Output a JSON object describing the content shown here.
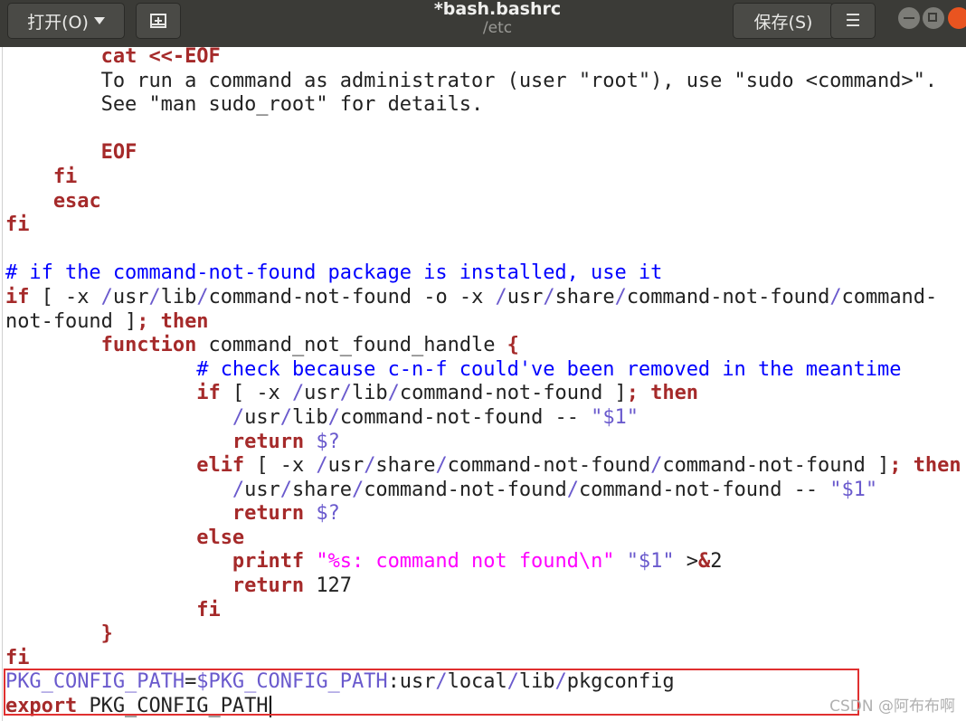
{
  "titlebar": {
    "open_label": "打开(O)",
    "title": "*bash.bashrc",
    "subtitle": "/etc",
    "save_label": "保存(S)",
    "menu_icon": "☰",
    "newdoc_icon": "new-document-icon"
  },
  "code_lines": [
    [
      [
        "        ",
        ""
      ],
      [
        "cat <<-EOF",
        "kw"
      ]
    ],
    [
      [
        "        To run a command as administrator (user \"root\"), use \"sudo <command>\".",
        ""
      ]
    ],
    [
      [
        "        See \"man sudo_root\" for details.",
        ""
      ]
    ],
    [
      [
        "",
        ""
      ]
    ],
    [
      [
        "        ",
        ""
      ],
      [
        "EOF",
        "kw"
      ]
    ],
    [
      [
        "    ",
        ""
      ],
      [
        "fi",
        "kw"
      ]
    ],
    [
      [
        "    ",
        ""
      ],
      [
        "esac",
        "kw"
      ]
    ],
    [
      [
        "fi",
        "kw"
      ]
    ],
    [
      [
        "",
        ""
      ]
    ],
    [
      [
        "# if the command-not-found package is installed, use it",
        "cm"
      ]
    ],
    [
      [
        "if",
        "kw"
      ],
      [
        " [ -x ",
        ""
      ],
      [
        "/",
        "sl"
      ],
      [
        "usr",
        ""
      ],
      [
        "/",
        "sl"
      ],
      [
        "lib",
        ""
      ],
      [
        "/",
        "sl"
      ],
      [
        "command-not-found -o -x ",
        ""
      ],
      [
        "/",
        "sl"
      ],
      [
        "usr",
        ""
      ],
      [
        "/",
        "sl"
      ],
      [
        "share",
        ""
      ],
      [
        "/",
        "sl"
      ],
      [
        "command-not-found",
        ""
      ],
      [
        "/",
        "sl"
      ],
      [
        "command-",
        ""
      ]
    ],
    [
      [
        "not-found ]",
        ""
      ],
      [
        "; then",
        "kw"
      ]
    ],
    [
      [
        "        ",
        ""
      ],
      [
        "function",
        "kw"
      ],
      [
        " command_not_found_handle ",
        ""
      ],
      [
        "{",
        "kw"
      ]
    ],
    [
      [
        "                ",
        ""
      ],
      [
        "# check because c-n-f could've been removed in the meantime",
        "cm"
      ]
    ],
    [
      [
        "                ",
        ""
      ],
      [
        "if",
        "kw"
      ],
      [
        " [ -x ",
        ""
      ],
      [
        "/",
        "sl"
      ],
      [
        "usr",
        ""
      ],
      [
        "/",
        "sl"
      ],
      [
        "lib",
        ""
      ],
      [
        "/",
        "sl"
      ],
      [
        "command-not-found ]",
        ""
      ],
      [
        "; then",
        "kw"
      ]
    ],
    [
      [
        "                   ",
        ""
      ],
      [
        "/",
        "sl"
      ],
      [
        "usr",
        ""
      ],
      [
        "/",
        "sl"
      ],
      [
        "lib",
        ""
      ],
      [
        "/",
        "sl"
      ],
      [
        "command-not-found -- ",
        ""
      ],
      [
        "\"$1\"",
        "vr"
      ]
    ],
    [
      [
        "                   ",
        ""
      ],
      [
        "return",
        "kw"
      ],
      [
        " ",
        ""
      ],
      [
        "$?",
        "vr"
      ]
    ],
    [
      [
        "                ",
        ""
      ],
      [
        "elif",
        "kw"
      ],
      [
        " [ -x ",
        ""
      ],
      [
        "/",
        "sl"
      ],
      [
        "usr",
        ""
      ],
      [
        "/",
        "sl"
      ],
      [
        "share",
        ""
      ],
      [
        "/",
        "sl"
      ],
      [
        "command-not-found",
        ""
      ],
      [
        "/",
        "sl"
      ],
      [
        "command-not-found ]",
        ""
      ],
      [
        "; then",
        "kw"
      ]
    ],
    [
      [
        "                   ",
        ""
      ],
      [
        "/",
        "sl"
      ],
      [
        "usr",
        ""
      ],
      [
        "/",
        "sl"
      ],
      [
        "share",
        ""
      ],
      [
        "/",
        "sl"
      ],
      [
        "command-not-found",
        ""
      ],
      [
        "/",
        "sl"
      ],
      [
        "command-not-found -- ",
        ""
      ],
      [
        "\"$1\"",
        "vr"
      ]
    ],
    [
      [
        "                   ",
        ""
      ],
      [
        "return",
        "kw"
      ],
      [
        " ",
        ""
      ],
      [
        "$?",
        "vr"
      ]
    ],
    [
      [
        "                ",
        ""
      ],
      [
        "else",
        "kw"
      ]
    ],
    [
      [
        "                   ",
        ""
      ],
      [
        "printf",
        "kw"
      ],
      [
        " ",
        ""
      ],
      [
        "\"%s: command not found\\n\"",
        "st"
      ],
      [
        " ",
        ""
      ],
      [
        "\"$1\"",
        "vr"
      ],
      [
        " >",
        ""
      ],
      [
        "&",
        "kw"
      ],
      [
        "2",
        ""
      ]
    ],
    [
      [
        "                   ",
        ""
      ],
      [
        "return",
        "kw"
      ],
      [
        " 127",
        ""
      ]
    ],
    [
      [
        "                ",
        ""
      ],
      [
        "fi",
        "kw"
      ]
    ],
    [
      [
        "        ",
        ""
      ],
      [
        "}",
        "kw"
      ]
    ],
    [
      [
        "fi",
        "kw"
      ]
    ],
    [
      [
        "PKG_CONFIG_PATH",
        "vr"
      ],
      [
        "=",
        ""
      ],
      [
        "$PKG_CONFIG_PATH",
        "vr"
      ],
      [
        ":usr",
        ""
      ],
      [
        "/",
        "sl"
      ],
      [
        "local",
        ""
      ],
      [
        "/",
        "sl"
      ],
      [
        "lib",
        ""
      ],
      [
        "/",
        "sl"
      ],
      [
        "pkgconfig",
        ""
      ]
    ],
    [
      [
        "export",
        "kw"
      ],
      [
        " PKG_CONFIG_PATH",
        ""
      ]
    ]
  ],
  "watermark": "CSDN @阿布布啊"
}
